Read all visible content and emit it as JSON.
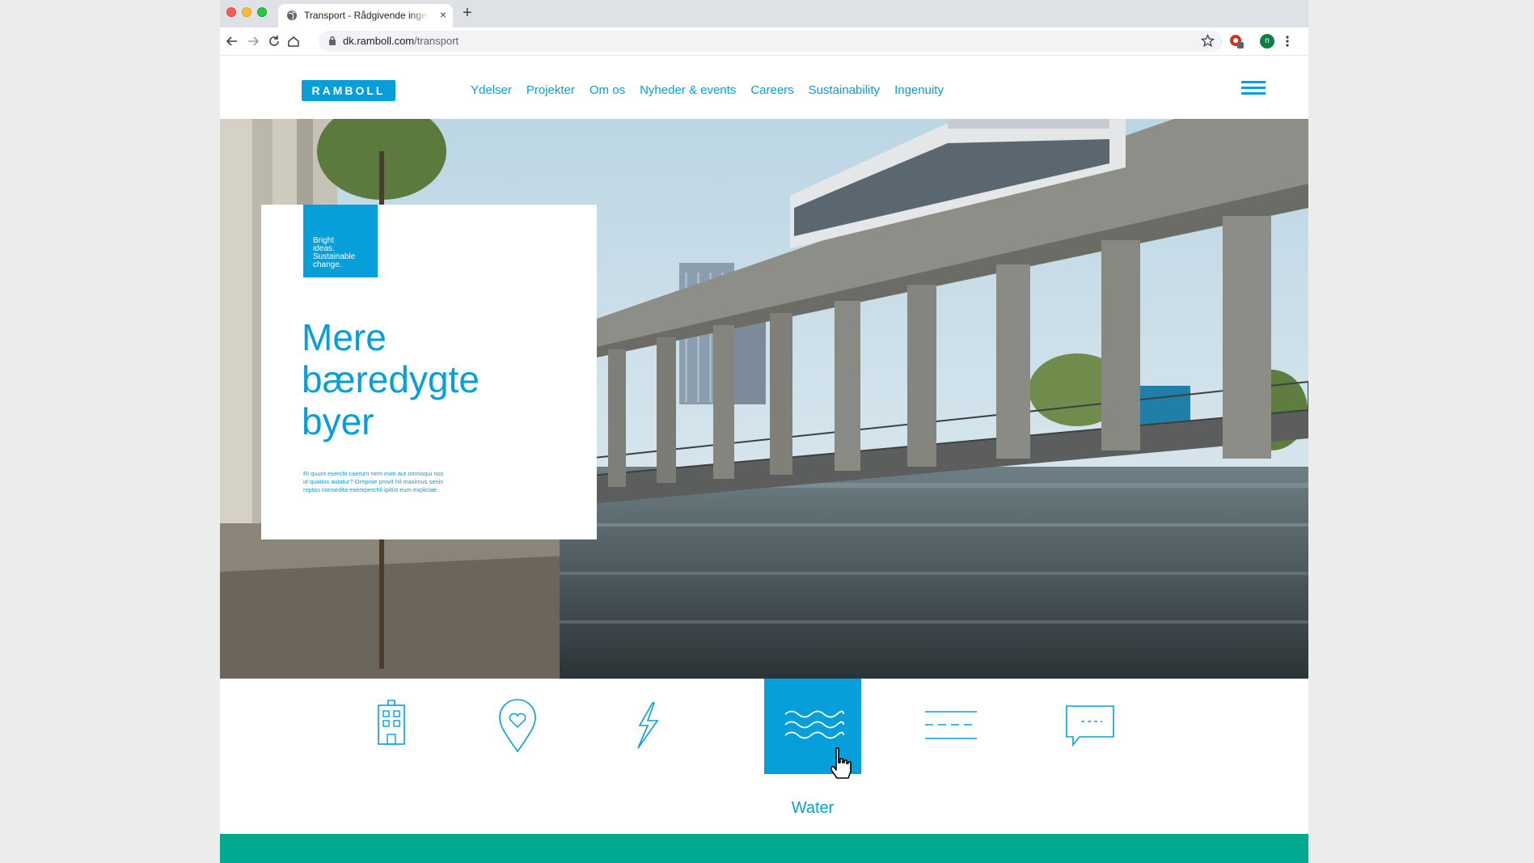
{
  "browser": {
    "tab_title": "Transport - Rådgivende ingeniører",
    "url_domain": "dk.ramboll.com",
    "url_path": "/transport",
    "profile_initial": "n"
  },
  "site": {
    "logo": "RAMBOLL",
    "nav": [
      "Ydelser",
      "Projekter",
      "Om os",
      "Nyheder & events",
      "Careers",
      "Sustainability",
      "Ingenuity"
    ]
  },
  "hero": {
    "tagline_lines": [
      "Bright",
      "ideas.",
      "Sustainable",
      "change."
    ],
    "title_lines": [
      "Mere",
      "bæredygte",
      "byer"
    ],
    "body_lines": [
      "Ri quunt exerchi caerum nem eum aut omnisqui nos",
      "id quatios autatur? Oreprae provit hil maximus senis",
      "reptas consedita exereperchil ipitist eum expliciae."
    ]
  },
  "icon_row": {
    "items": [
      {
        "name": "building-icon",
        "active": false
      },
      {
        "name": "location-heart-icon",
        "active": false
      },
      {
        "name": "lightning-icon",
        "active": false
      },
      {
        "name": "water-waves-icon",
        "active": true
      },
      {
        "name": "lines-icon",
        "active": false
      },
      {
        "name": "chat-bubble-icon",
        "active": false
      }
    ],
    "active_label": "Water"
  },
  "colors": {
    "brand_blue": "#069fd9",
    "band_green": "#00a98f"
  }
}
